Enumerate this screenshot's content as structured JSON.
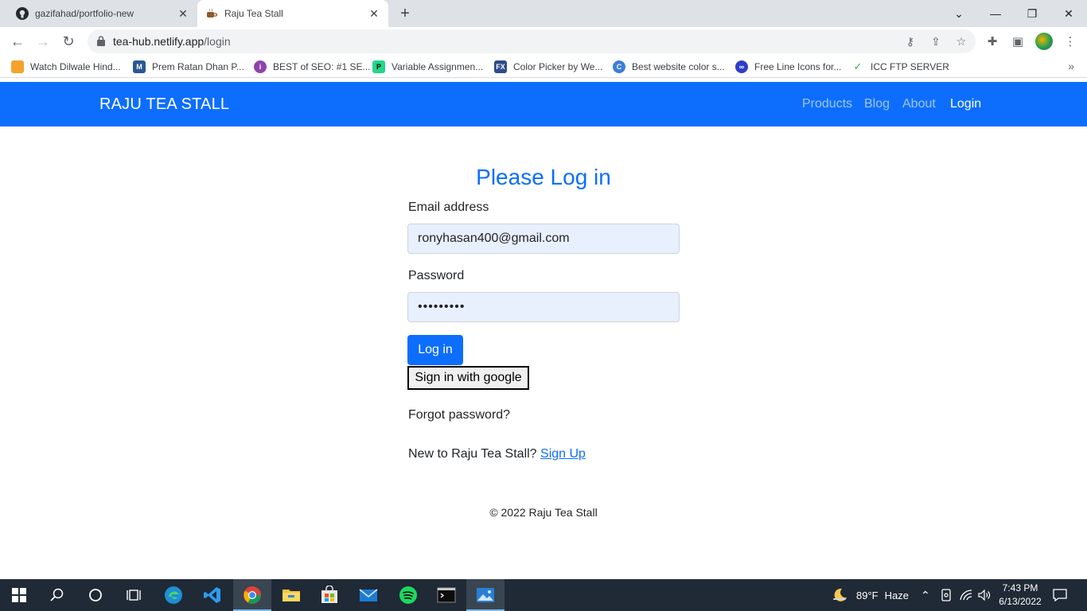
{
  "browser": {
    "tabs": [
      {
        "title": "gazifahad/portfolio-new",
        "icon": "github-icon"
      },
      {
        "title": "Raju Tea Stall",
        "icon": "tea-icon"
      }
    ],
    "url_host": "tea-hub.netlify.app",
    "url_path": "/login",
    "bookmarks": [
      {
        "label": "Watch Dilwale Hind...",
        "color": "#f4a22c"
      },
      {
        "label": "Prem Ratan Dhan P...",
        "color": "#2b5797"
      },
      {
        "label": "BEST of SEO: #1 SE...",
        "color": "#8e44ad"
      },
      {
        "label": "Variable Assignmen...",
        "color": "#21d789"
      },
      {
        "label": "Color Picker by We...",
        "color": "#2e4b8c"
      },
      {
        "label": "Best website color s...",
        "color": "#3d7ddb"
      },
      {
        "label": "Free Line Icons for...",
        "color": "#2f3ec8"
      },
      {
        "label": "ICC FTP SERVER",
        "color": "#35a845"
      }
    ]
  },
  "navbar": {
    "brand": "RAJU TEA STALL",
    "links": [
      "Products",
      "Blog",
      "About",
      "Login"
    ]
  },
  "login": {
    "heading": "Please Log in",
    "email_label": "Email address",
    "email_value": "ronyhasan400@gmail.com",
    "password_label": "Password",
    "password_value": "•••••••••",
    "login_button": "Log in",
    "google_button": "Sign in with google",
    "forgot": "Forgot password?",
    "new_user_text": "New to Raju Tea Stall?",
    "signup_link": "Sign Up"
  },
  "footer": {
    "text": "© 2022 Raju Tea Stall"
  },
  "taskbar": {
    "weather_temp": "89°F",
    "weather_text": "Haze",
    "time": "7:43 PM",
    "date": "6/13/2022"
  }
}
